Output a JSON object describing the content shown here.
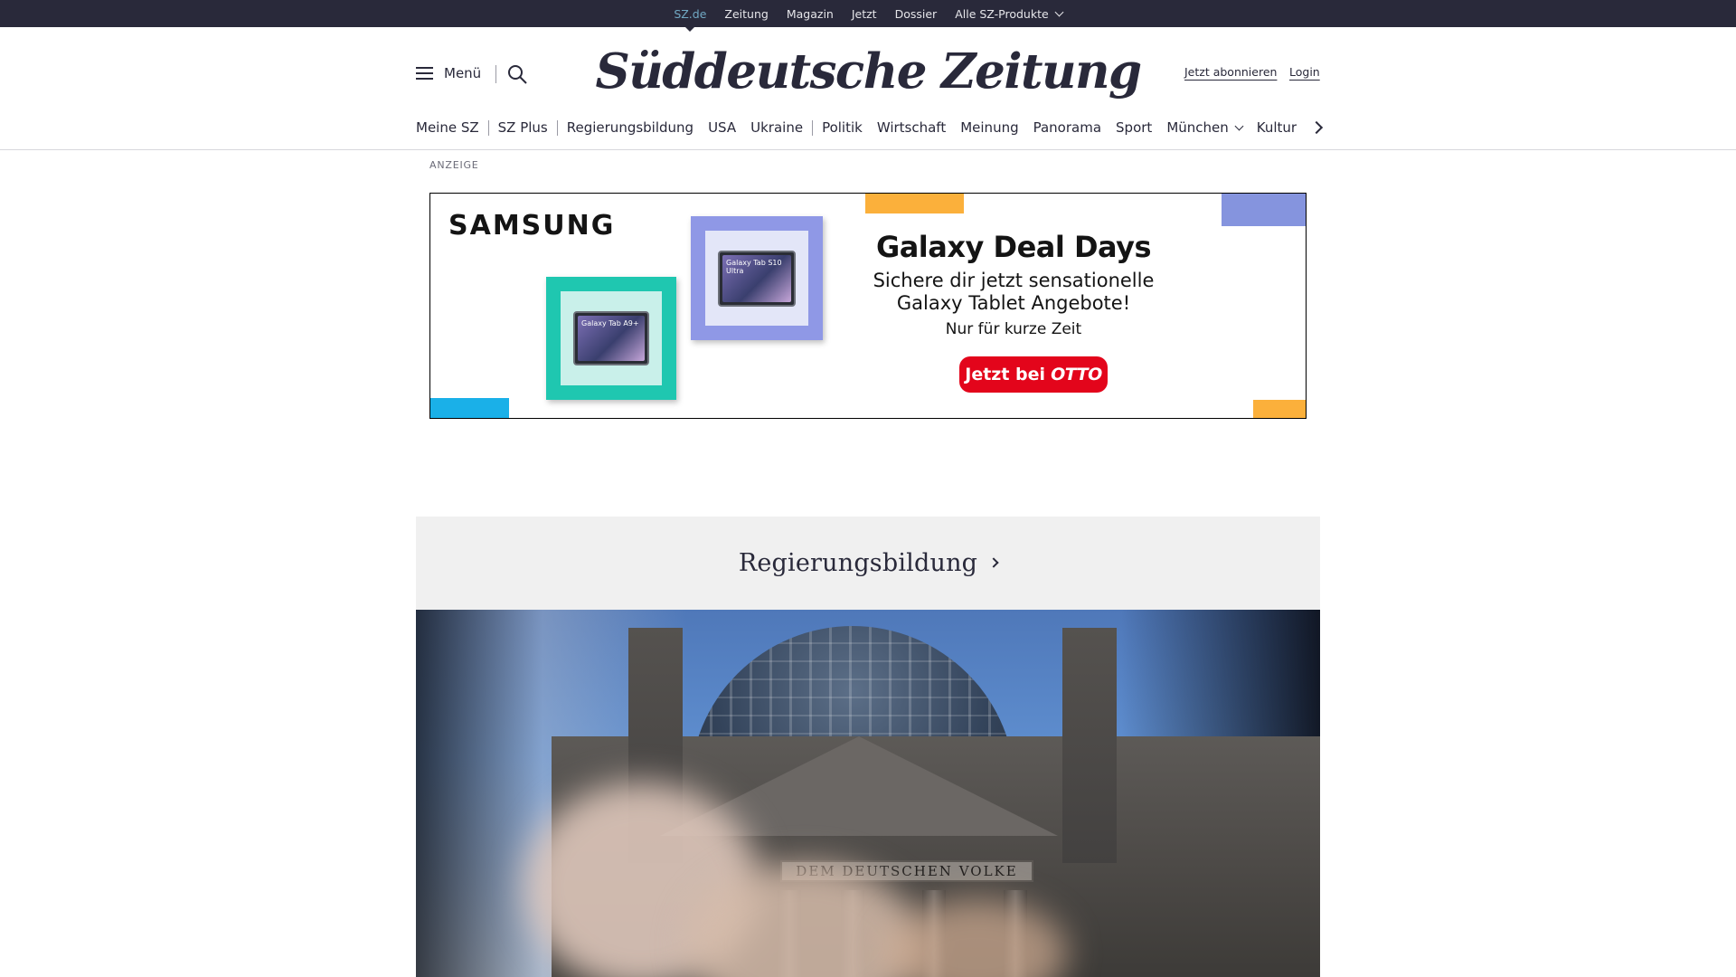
{
  "topbar": {
    "links": [
      "SZ.de",
      "Zeitung",
      "Magazin",
      "Jetzt",
      "Dossier"
    ],
    "products_label": "Alle SZ-Produkte"
  },
  "header": {
    "menu_label": "Menü",
    "logo_text": "Süddeutsche Zeitung",
    "subscribe_label": "Jetzt abonnieren",
    "login_label": "Login"
  },
  "nav": {
    "items": [
      "Meine SZ",
      "SZ Plus",
      "Regierungsbildung",
      "USA",
      "Ukraine",
      "Politik",
      "Wirtschaft",
      "Meinung",
      "Panorama",
      "Sport",
      "München",
      "Kultur"
    ]
  },
  "ad": {
    "label": "ANZEIGE",
    "brand": "SAMSUNG",
    "headline": "Galaxy Deal Days",
    "subline": "Sichere dir jetzt sensationelle Galaxy Tablet Angebote!",
    "note": "Nur für kurze Zeit",
    "cta_prefix": "Jetzt bei",
    "cta_brand": "OTTO",
    "tablet_labels": [
      "Galaxy Tab A9+",
      "Galaxy Tab S10 Ultra"
    ]
  },
  "section": {
    "title": "Regierungsbildung"
  },
  "hero": {
    "inscription": "DEM DEUTSCHEN VOLKE"
  },
  "colors": {
    "topbar_bg": "#29293a",
    "active_link": "#71a9c4",
    "section_bg": "#f0f0f0",
    "cta_red": "#e3051b"
  }
}
